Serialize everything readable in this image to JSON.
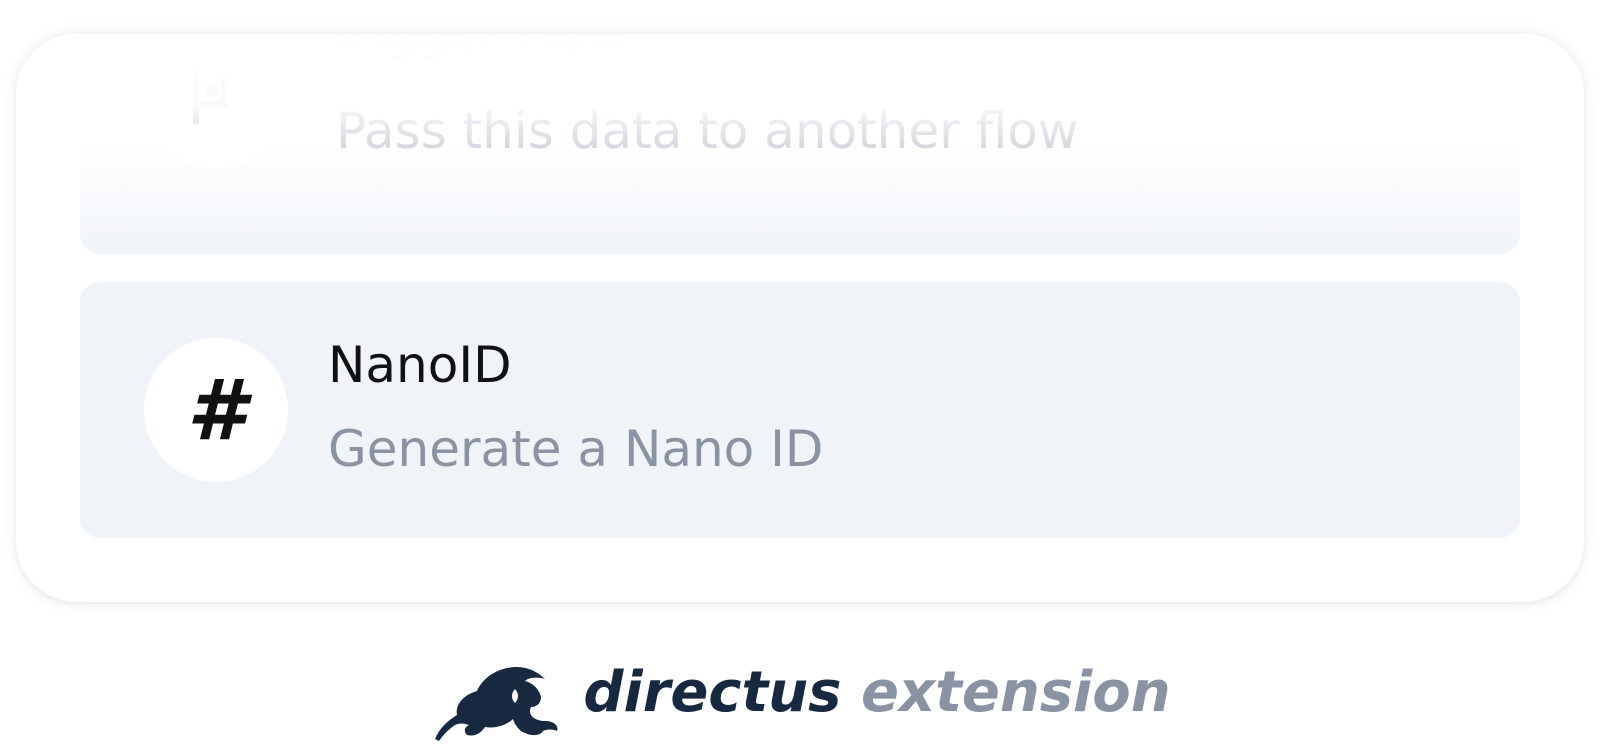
{
  "operations": [
    {
      "title": "Trigger Flow",
      "description": "Pass this data to another flow",
      "icon": "flow-trigger-icon"
    },
    {
      "title": "NanoID",
      "description": "Generate a Nano ID",
      "icon": "hash-icon",
      "icon_glyph": "#"
    }
  ],
  "footer": {
    "logo": "directus-rabbit-logo",
    "brand_word": "directus",
    "tag_word": "extension"
  },
  "colors": {
    "card_bg": "#ffffff",
    "item_bg": "#f0f4f9",
    "title": "#111111",
    "description": "#8a93a3",
    "brand_dark": "#172940",
    "brand_gray": "#8a93a3"
  }
}
